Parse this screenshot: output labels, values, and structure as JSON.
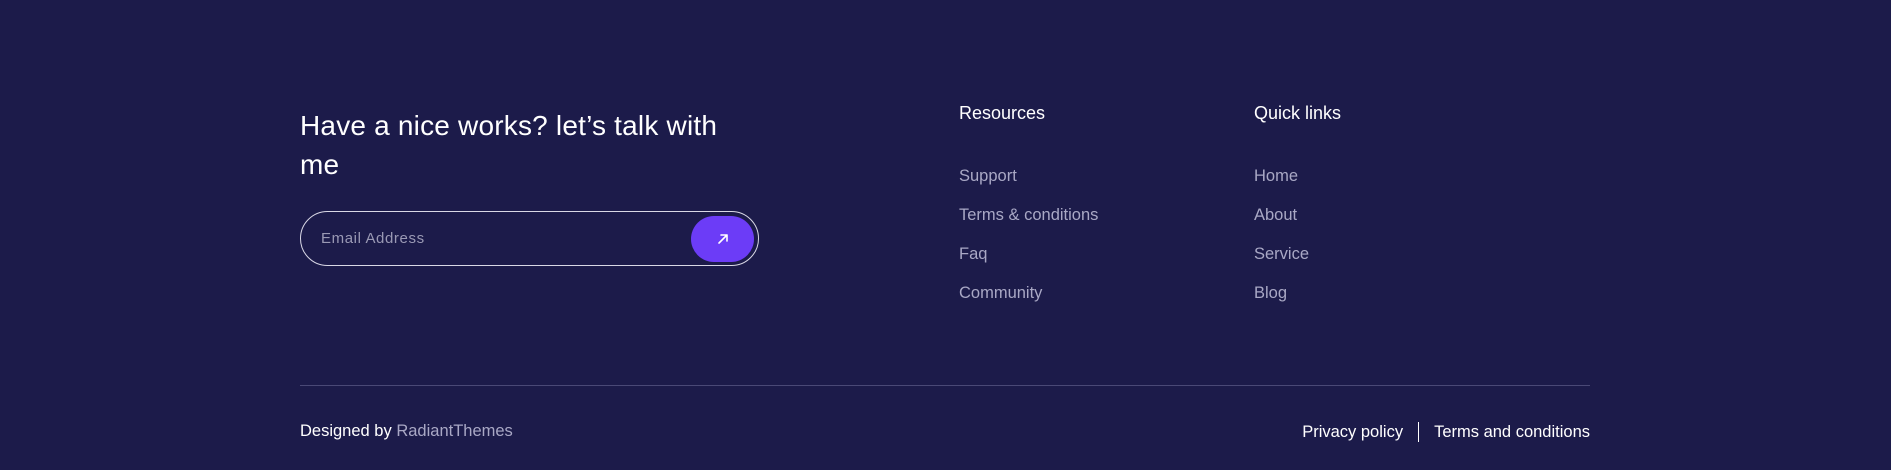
{
  "cta": {
    "heading": "Have a nice works? let’s talk with me",
    "email_placeholder": "Email Address",
    "submit_icon": "arrow-up-right-icon"
  },
  "resources": {
    "title": "Resources",
    "items": [
      {
        "label": "Support"
      },
      {
        "label": "Terms & conditions"
      },
      {
        "label": "Faq"
      },
      {
        "label": "Community"
      }
    ]
  },
  "quick_links": {
    "title": "Quick links",
    "items": [
      {
        "label": "Home"
      },
      {
        "label": "About"
      },
      {
        "label": "Service"
      },
      {
        "label": "Blog"
      }
    ]
  },
  "bottom": {
    "designed_by": "Designed by",
    "brand": "RadiantThemes",
    "privacy": "Privacy policy",
    "terms": "Terms and conditions"
  },
  "colors": {
    "background": "#1c1b4a",
    "accent": "#6c3cf7",
    "muted_text": "#a9a8c5"
  }
}
